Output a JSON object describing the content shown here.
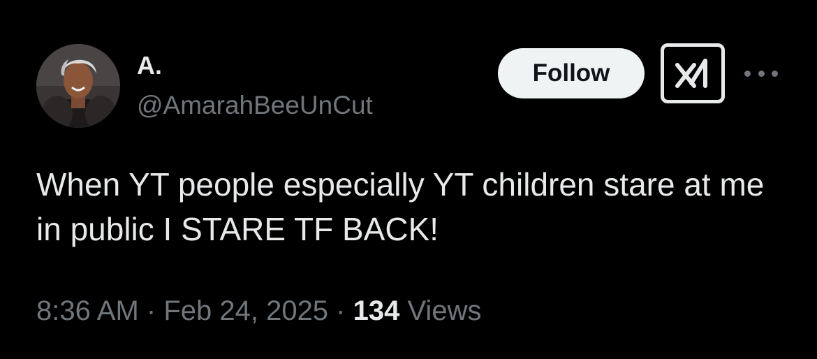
{
  "author": {
    "display_name": "A.",
    "handle": "@AmarahBeeUnCut"
  },
  "actions": {
    "follow_label": "Follow",
    "grok_icon": "grok-logo-icon",
    "more_icon": "more-horizontal-icon"
  },
  "tweet": {
    "text": "When YT people especially YT children stare at me in public I STARE TF BACK!"
  },
  "meta": {
    "time": "8:36 AM",
    "separator": " · ",
    "date": "Feb 24, 2025",
    "views_count": "134",
    "views_label": " Views"
  },
  "colors": {
    "background": "#000000",
    "primary_text": "#e7e9ea",
    "secondary_text": "#71767b",
    "follow_bg": "#eff3f4"
  }
}
